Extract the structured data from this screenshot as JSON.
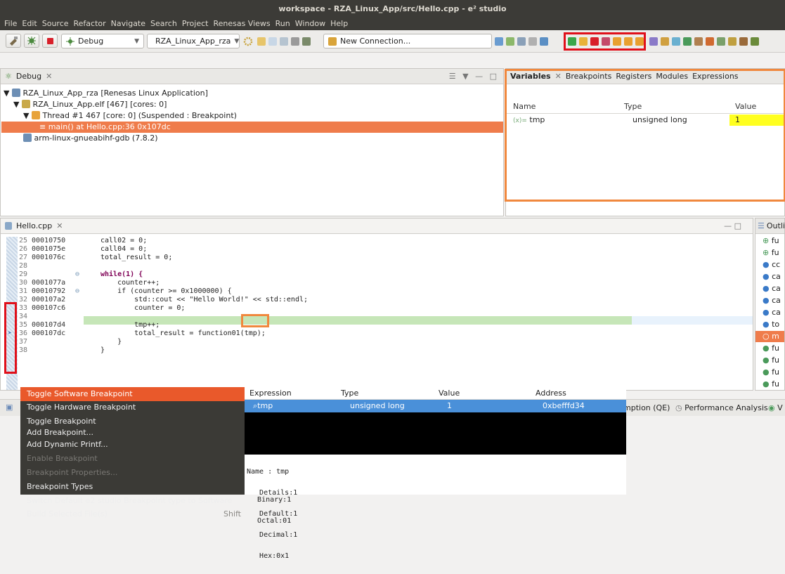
{
  "window": {
    "title": "workspace - RZA_Linux_App/src/Hello.cpp - e² studio"
  },
  "menu": [
    "File",
    "Edit",
    "Source",
    "Refactor",
    "Navigate",
    "Search",
    "Project",
    "Renesas Views",
    "Run",
    "Window",
    "Help"
  ],
  "toolbar": {
    "launch_mode": "Debug",
    "launch_config": "RZA_Linux_App_rza",
    "connection": "New Connection..."
  },
  "debug_view": {
    "tab": "Debug",
    "rows": [
      "RZA_Linux_App_rza [Renesas Linux Application]",
      "RZA_Linux_App.elf [467] [cores: 0]",
      "Thread #1 467 [core: 0] (Suspended : Breakpoint)",
      "main() at Hello.cpp:36 0x107dc",
      "arm-linux-gnueabihf-gdb (7.8.2)"
    ]
  },
  "variables_view": {
    "tabs": [
      "Variables",
      "Breakpoints",
      "Registers",
      "Modules",
      "Expressions"
    ],
    "columns": [
      "Name",
      "Type",
      "Value"
    ],
    "rows": [
      {
        "name": "tmp",
        "type": "unsigned long",
        "value": "1"
      }
    ]
  },
  "editor": {
    "tab": "Hello.cpp",
    "lines": [
      {
        "num": "25",
        "addr": "00010750",
        "src": "call02 = 0;"
      },
      {
        "num": "26",
        "addr": "0001075e",
        "src": "call04 = 0;"
      },
      {
        "num": "27",
        "addr": "0001076c",
        "src": "total_result = 0;"
      },
      {
        "num": "28",
        "addr": "",
        "src": ""
      },
      {
        "num": "29",
        "addr": "",
        "src": "while(1) {"
      },
      {
        "num": "30",
        "addr": "0001077a",
        "src": "    counter++;"
      },
      {
        "num": "31",
        "addr": "00010792",
        "src": "    if (counter >= 0x1000000) {"
      },
      {
        "num": "32",
        "addr": "000107a2",
        "src": "        std::cout << \"Hello World!\" << std::endl;"
      },
      {
        "num": "33",
        "addr": "000107c6",
        "src": "        counter = 0;"
      },
      {
        "num": "34",
        "addr": "",
        "src": ""
      },
      {
        "num": "35",
        "addr": "000107d4",
        "src": "        tmp++;"
      },
      {
        "num": "36",
        "addr": "000107dc",
        "src": "        total_result = function01(tmp);"
      },
      {
        "num": "37",
        "addr": "",
        "src": "    }"
      },
      {
        "num": "38",
        "addr": "",
        "src": "}"
      }
    ]
  },
  "outline": {
    "tab": "Outli",
    "items": [
      "fu",
      "fu",
      "cc",
      "ca",
      "ca",
      "ca",
      "ca",
      "to",
      "m",
      "fu",
      "fu",
      "fu",
      "fu"
    ]
  },
  "bottom_tabs": [
    "mption (QE)",
    "Performance Analysis",
    "V"
  ],
  "context_menu": {
    "items": [
      {
        "label": "Toggle Software Breakpoint",
        "state": "selected",
        "shortcut": ""
      },
      {
        "label": "Toggle Hardware Breakpoint",
        "state": "normal",
        "shortcut": ""
      },
      {
        "label": "Toggle Breakpoint",
        "state": "normal",
        "shortcut": ""
      },
      {
        "label": "Add Breakpoint...",
        "state": "normal",
        "shortcut": ""
      },
      {
        "label": "Add Dynamic Printf...",
        "state": "normal",
        "shortcut": ""
      },
      {
        "label": "Enable Breakpoint",
        "state": "disabled",
        "shortcut": ""
      },
      {
        "label": "Breakpoint Properties...",
        "state": "disabled",
        "shortcut": ""
      },
      {
        "label": "Breakpoint Types",
        "state": "normal",
        "shortcut": ""
      },
      {
        "label": "Switch Default e2 studio Breakpoint type to Software",
        "state": "normal",
        "shortcut": ""
      },
      {
        "label": "Build Selected File(s)",
        "state": "normal",
        "shortcut": "Shift"
      }
    ]
  },
  "hover": {
    "columns": [
      "Expression",
      "Type",
      "Value",
      "Address"
    ],
    "row": {
      "expression": "tmp",
      "type": "unsigned long",
      "value": "1",
      "address": "0xbefffd34"
    },
    "details": [
      "Name : tmp",
      "   Details:1",
      "   Default:1",
      "   Decimal:1",
      "   Hex:0x1",
      "   Binary:1",
      "   Octal:01"
    ]
  }
}
